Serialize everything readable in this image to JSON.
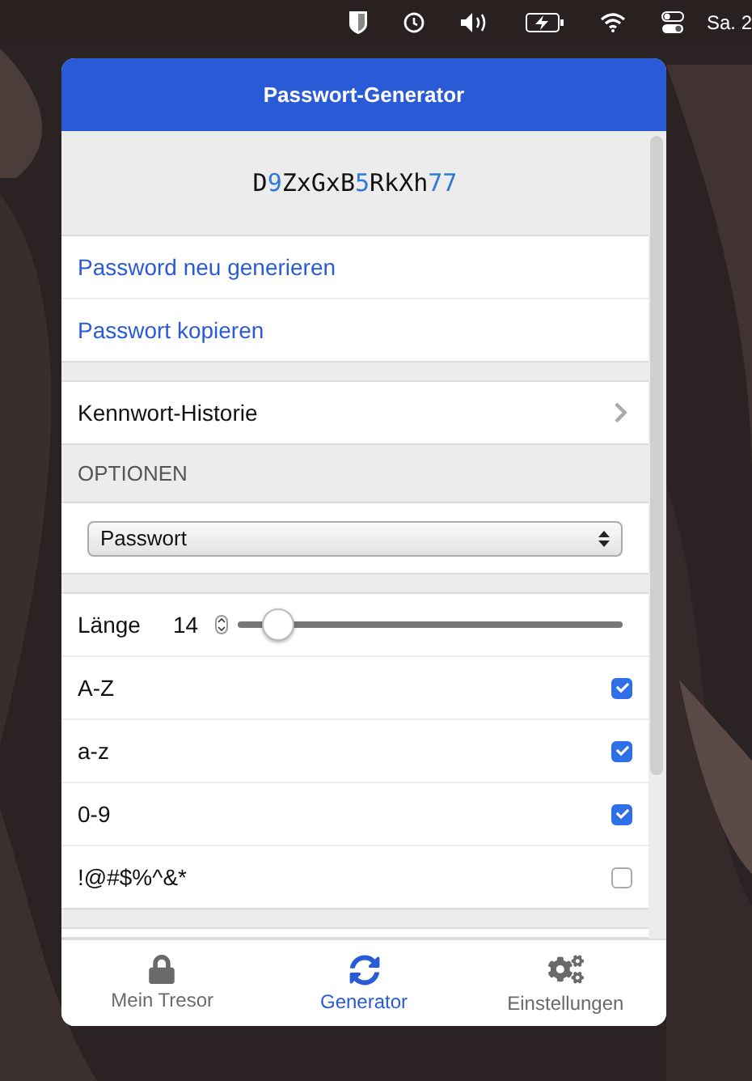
{
  "menu_bar": {
    "clock": "Sa. 2"
  },
  "popup": {
    "title": "Passwort-Generator",
    "password": [
      {
        "text": "D",
        "kind": "letter"
      },
      {
        "text": "9",
        "kind": "digit"
      },
      {
        "text": "ZxGxB",
        "kind": "letter"
      },
      {
        "text": "5",
        "kind": "digit"
      },
      {
        "text": "RkXh",
        "kind": "letter"
      },
      {
        "text": "77",
        "kind": "digit"
      }
    ],
    "actions": [
      "Password neu generieren",
      "Passwort kopieren"
    ],
    "history": {
      "label": "Kennwort-Historie"
    },
    "options_header": "OPTIONEN",
    "type_select": {
      "value": "Passwort"
    },
    "length": {
      "label": "Länge",
      "value": "14",
      "level": 0.1
    },
    "options": [
      {
        "label": "A-Z",
        "checked": true
      },
      {
        "label": "a-z",
        "checked": true
      },
      {
        "label": "0-9",
        "checked": true
      },
      {
        "label": "!@#$%^&*",
        "checked": false
      }
    ],
    "tabs": [
      {
        "label": "Mein Tresor",
        "selected": false
      },
      {
        "label": "Generator",
        "selected": true
      },
      {
        "label": "Einstellungen",
        "selected": false
      }
    ]
  }
}
